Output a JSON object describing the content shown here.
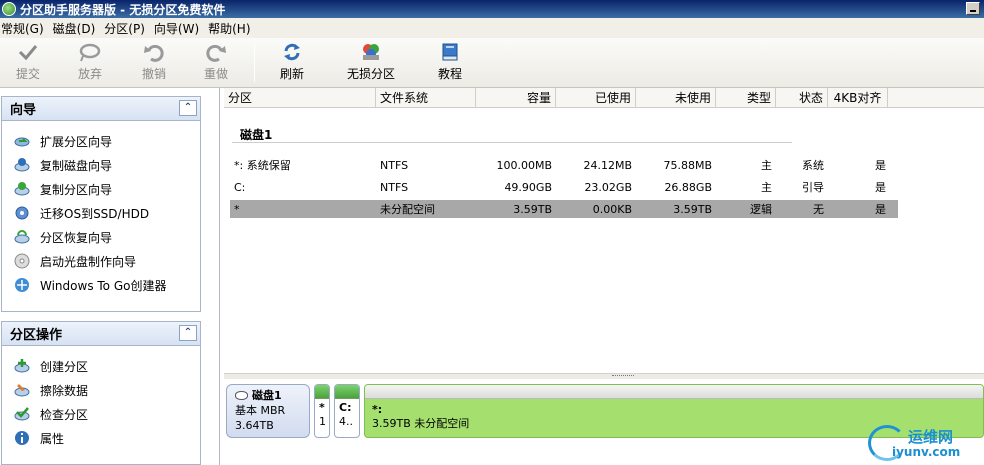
{
  "window": {
    "title": "分区助手服务器版 - 无损分区免费软件"
  },
  "menu": [
    "常规(G)",
    "磁盘(D)",
    "分区(P)",
    "向导(W)",
    "帮助(H)"
  ],
  "toolbar": {
    "commit": "提交",
    "discard": "放弃",
    "undo": "撤销",
    "redo": "重做",
    "refresh": "刷新",
    "lossless": "无损分区",
    "tutorial": "教程"
  },
  "wizard_panel": {
    "title": "向导",
    "items": [
      "扩展分区向导",
      "复制磁盘向导",
      "复制分区向导",
      "迁移OS到SSD/HDD",
      "分区恢复向导",
      "启动光盘制作向导",
      "Windows To Go创建器"
    ]
  },
  "ops_panel": {
    "title": "分区操作",
    "items": [
      "创建分区",
      "擦除数据",
      "检查分区",
      "属性"
    ]
  },
  "table": {
    "columns": [
      "分区",
      "文件系统",
      "容量",
      "已使用",
      "未使用",
      "类型",
      "状态",
      "4KB对齐"
    ],
    "disk_label": "磁盘1",
    "rows": [
      [
        "*: 系统保留",
        "NTFS",
        "100.00MB",
        "24.12MB",
        "75.88MB",
        "主",
        "系统",
        "是"
      ],
      [
        "C:",
        "NTFS",
        "49.90GB",
        "23.02GB",
        "26.88GB",
        "主",
        "引导",
        "是"
      ],
      [
        "*",
        "未分配空间",
        "3.59TB",
        "0.00KB",
        "3.59TB",
        "逻辑",
        "无",
        "是"
      ]
    ]
  },
  "disk_map": {
    "disk_name": "磁盘1",
    "disk_type": "基本 MBR",
    "disk_size": "3.64TB",
    "part1_label": "*",
    "part1_sub": "1",
    "part2_label": "C:",
    "part2_sub": "4..",
    "unalloc_label": "*:",
    "unalloc_desc": "3.59TB 未分配空间"
  },
  "watermark": {
    "line1": "运维网",
    "line2": "iyunv.com"
  }
}
